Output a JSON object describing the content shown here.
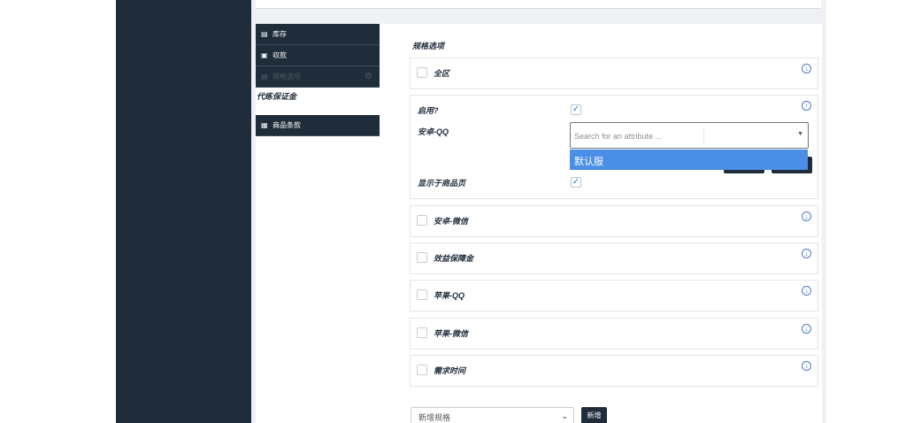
{
  "tabs": {
    "inventory": "库存",
    "payment": "収款",
    "spec_options": "规格选项",
    "deposit_label": "代练保证金",
    "product_terms": "商品条款"
  },
  "options": {
    "title": "规格选项",
    "rows": [
      {
        "label": "全区"
      },
      {
        "label": "安卓-微信"
      },
      {
        "label": "效益保障金"
      },
      {
        "label": "苹果-QQ"
      },
      {
        "label": "苹果-微信"
      },
      {
        "label": "需求时间"
      }
    ],
    "expanded": {
      "enabled_label": "启用?",
      "android_qq_label": "安卓-QQ",
      "show_on_product_page_label": "显示于商品页",
      "attribute_placeholder": "Search for an attribute ...",
      "dropdown_option": "默认服"
    }
  },
  "footer": {
    "add_spec_select": "新增规格",
    "add_button": "新增"
  }
}
